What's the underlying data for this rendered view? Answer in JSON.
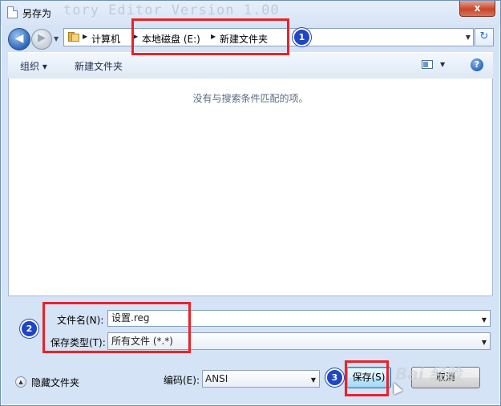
{
  "window": {
    "title": "另存为",
    "watermark_text": "tory Editor Version 1.00",
    "close_symbol": "x"
  },
  "nav": {
    "back_symbol": "◀",
    "forward_symbol": "▶",
    "breadcrumb": [
      "计算机",
      "本地磁盘 (E:)",
      "新建文件夹"
    ],
    "refresh_symbol": "↻"
  },
  "toolbar": {
    "organize_label": "组织 ▾",
    "new_folder_label": "新建文件夹",
    "help_symbol": "?"
  },
  "content": {
    "empty_message": "没有与搜索条件匹配的项。"
  },
  "form": {
    "filename_label": "文件名(N):",
    "filename_value": "设置.reg",
    "filetype_label": "保存类型(T):",
    "filetype_value": "所有文件  (*.*)",
    "encoding_label": "编码(E):",
    "encoding_value": "ANSI"
  },
  "footer": {
    "hide_folders_label": "隐藏文件夹",
    "save_label": "保存(S)",
    "cancel_label": "取消"
  },
  "annotations": {
    "step1": "1",
    "step2": "2",
    "step3": "3",
    "color": "#e8232a",
    "badge_color": "#1f46c4"
  },
  "overlay": {
    "site_watermark": "Bai 经验"
  },
  "icons": {
    "drop_arrow": "▼",
    "crumb_arrow": "▶",
    "hide_arrow": "▲"
  }
}
